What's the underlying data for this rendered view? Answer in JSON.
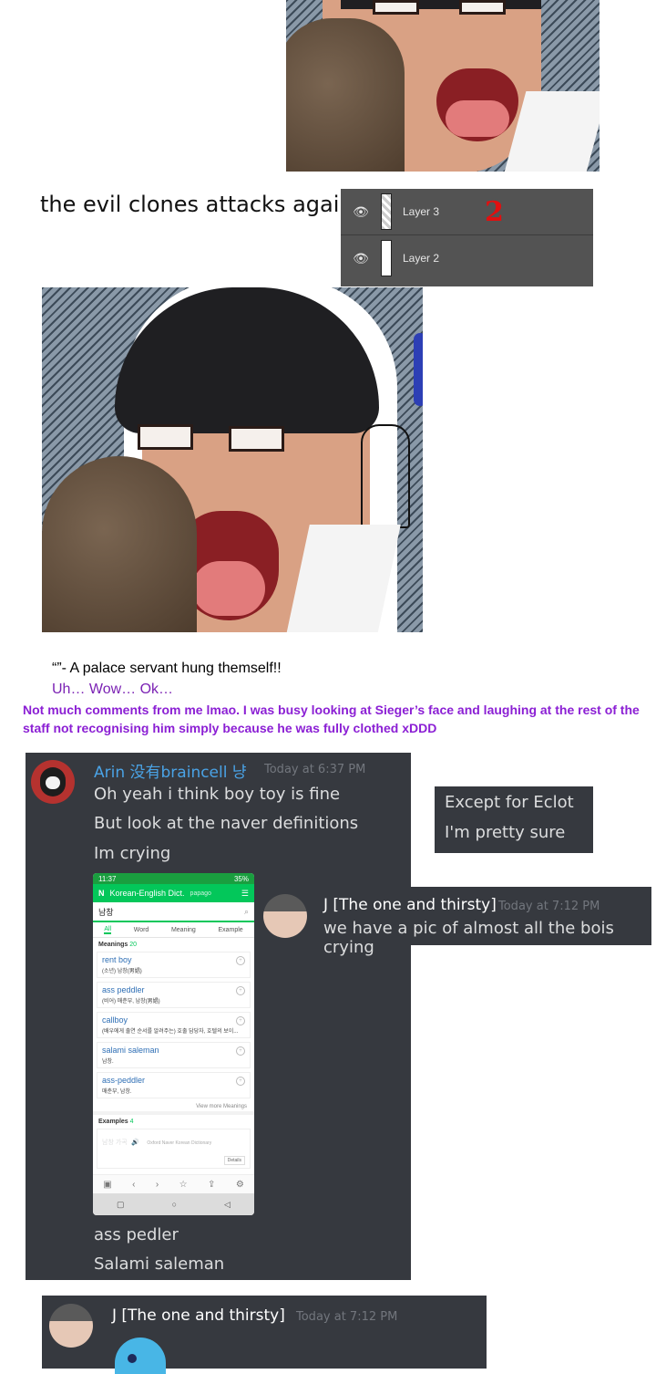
{
  "captions": {
    "evil_clones": "the evil clones attacks again",
    "quote": "“”- A palace servant hung themself!!",
    "reaction": "Uh… Wow… Ok…",
    "comment": "Not much comments from me lmao. I was busy looking at Sieger’s face and laughing at the rest of the staff not recognising him simply because he was fully clothed xDDD"
  },
  "layers_panel": {
    "layers": [
      {
        "name": "Layer 3",
        "visible": true
      },
      {
        "name": "Layer 2",
        "visible": true
      }
    ],
    "annotation": "2"
  },
  "chat_arin": {
    "username": "Arin 没有braincell 냥",
    "timestamp": "Today at 6:37 PM",
    "messages_top": [
      "Oh yeah i think boy toy is fine",
      "But look at the naver definitions",
      "Im crying"
    ],
    "messages_bottom": [
      "ass pedler",
      "Salami saleman"
    ]
  },
  "chat_box_small": {
    "lines": [
      "Except for Eclot",
      "I'm pretty sure"
    ]
  },
  "chat_j_1": {
    "username": "J [The one and thirsty]",
    "timestamp": "Today at 7:12 PM",
    "message": "we have a pic of almost all the bois crying"
  },
  "chat_j_2": {
    "username": "J [The one and thirsty]",
    "timestamp": "Today at 7:12 PM"
  },
  "phone": {
    "status_time": "11:37",
    "status_battery": "35%",
    "app_title": "Korean-English Dict.",
    "app_brand": "papago",
    "search_value": "남창",
    "tabs": [
      "All",
      "Word",
      "Meaning",
      "Example"
    ],
    "meanings_header": "Meanings",
    "meanings_count": "20",
    "meanings": [
      {
        "word": "rent boy",
        "def": "(소년) 남창(男娼)"
      },
      {
        "word": "ass peddler",
        "def": "(비어) 매춘부, 남창(男娼)"
      },
      {
        "word": "callboy",
        "def": "(배우에게 출연 순서를 알려주는) 호출 담당자, 호텔의 보이..."
      },
      {
        "word": "salami saleman",
        "def": "남창."
      },
      {
        "word": "ass-peddler",
        "def": "매춘부, 남창."
      }
    ],
    "view_more": "View more Meanings",
    "examples_header": "Examples",
    "examples_count": "4",
    "example_text": "남창 가곡",
    "example_source": "Oxford Naver Korean Dictionary",
    "example_button": "Details"
  }
}
